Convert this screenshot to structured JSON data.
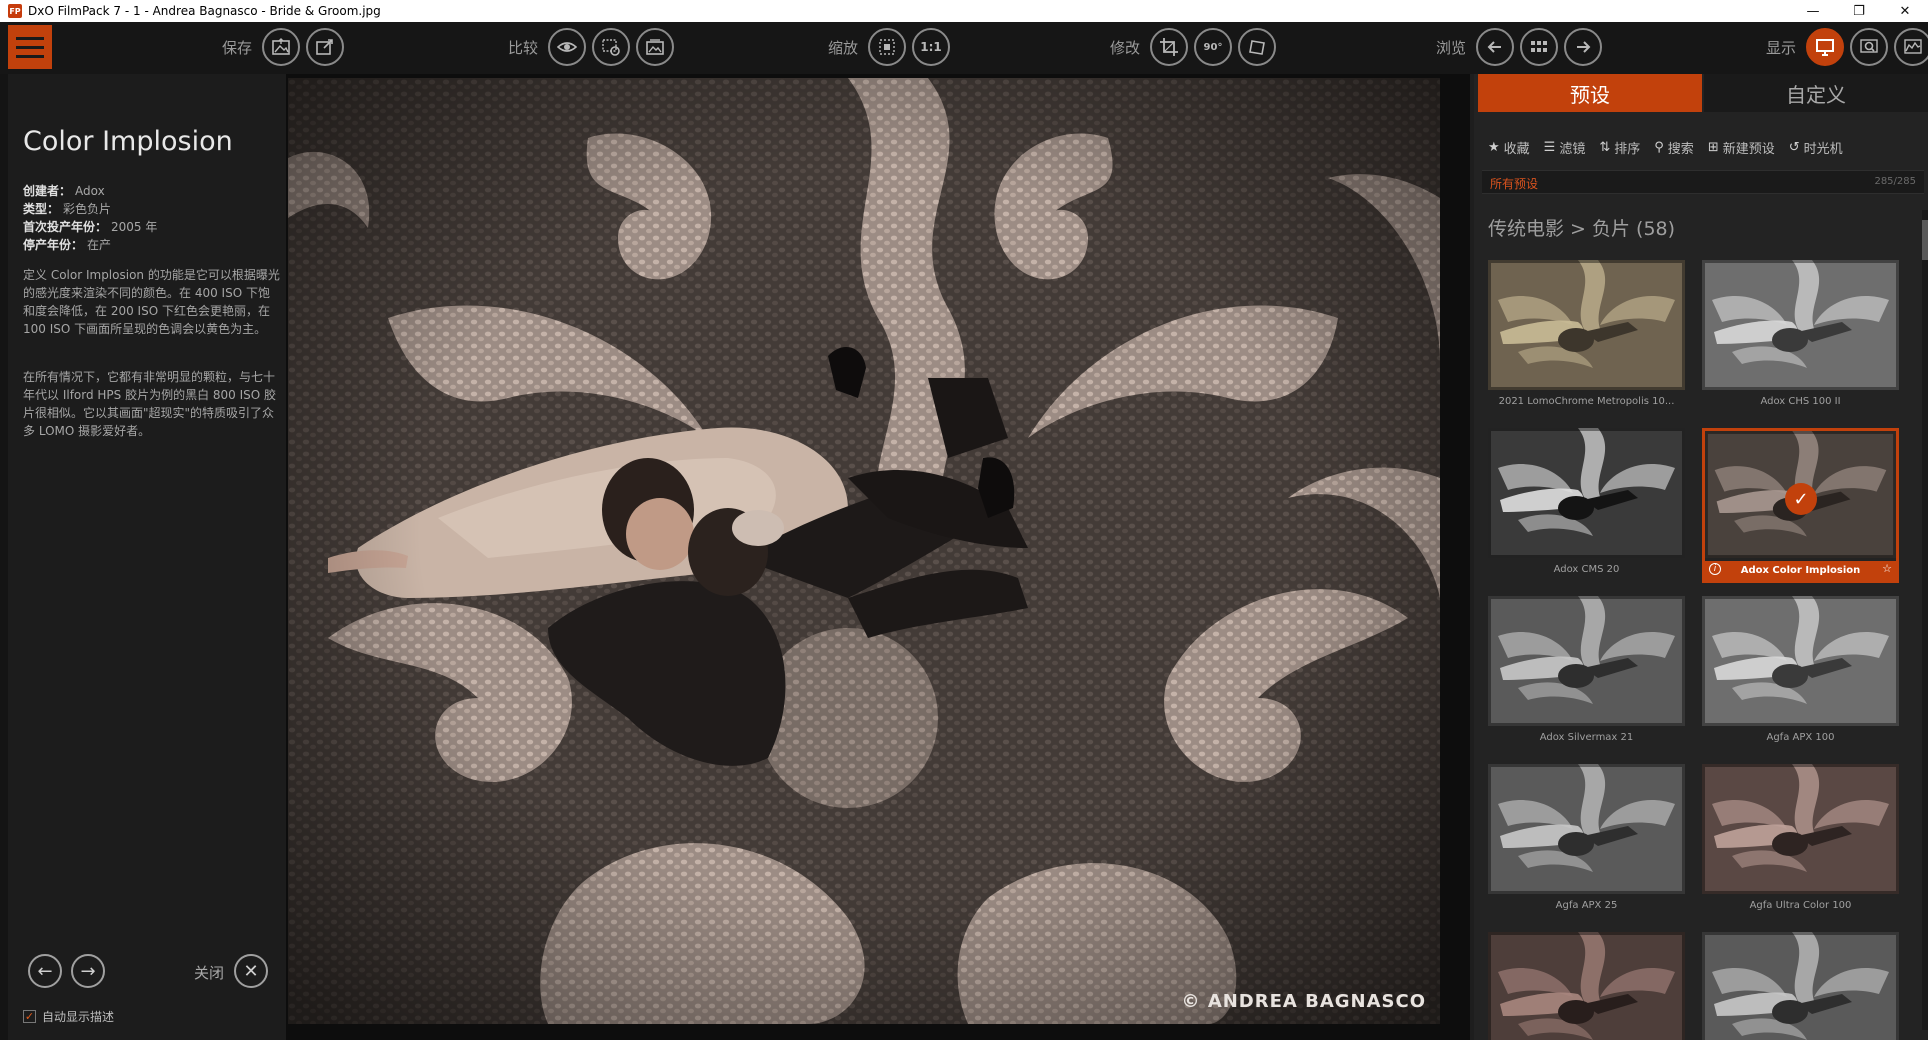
{
  "window": {
    "title": "DxO FilmPack 7 - 1 - Andrea Bagnasco - Bride & Groom.jpg",
    "app_icon_text": "FP",
    "minimize": "—",
    "maximize": "❐",
    "close": "✕"
  },
  "toolbar": {
    "save_label": "保存",
    "compare_label": "比较",
    "zoom_label": "缩放",
    "zoom_one_to_one": "1:1",
    "edit_label": "修改",
    "rotate_label": "90°",
    "browse_label": "浏览",
    "display_label": "显示"
  },
  "info": {
    "title": "Color Implosion",
    "rows": [
      {
        "k": "创建者：",
        "v": "Adox"
      },
      {
        "k": "类型：",
        "v": "彩色负片"
      },
      {
        "k": "首次投产年份：",
        "v": "2005 年"
      },
      {
        "k": "停产年份：",
        "v": "在产"
      }
    ],
    "desc1": "定义 Color Implosion 的功能是它可以根据曝光的感光度来渲染不同的颜色。在 400 ISO 下饱和度会降低，在 200 ISO 下红色会更艳丽，在 100 ISO 下画面所呈现的色调会以黄色为主。",
    "desc2": "在所有情况下，它都有非常明显的颗粒，与七十年代以 Ilford HPS 胶片为例的黑白 800 ISO 胶片很相似。它以其画面\"超现实\"的特质吸引了众多 LOMO 摄影爱好者。",
    "close_label": "关闭",
    "auto_desc_label": "自动显示描述"
  },
  "viewer": {
    "copyright": "© ANDREA BAGNASCO"
  },
  "presets": {
    "tab_presets": "预设",
    "tab_custom": "自定义",
    "filters": {
      "favorites": "收藏",
      "filter": "滤镜",
      "sort": "排序",
      "search": "搜索",
      "new_preset": "新建预设",
      "time_machine": "时光机"
    },
    "all_presets": "所有预设",
    "count": "285/285",
    "category": "传统电影 > 负片 (58)",
    "items": [
      {
        "label": "2021 LomoChrome Metropolis 10...",
        "tone": "warm-faded"
      },
      {
        "label": "Adox CHS 100 II",
        "tone": "bw-light"
      },
      {
        "label": "Adox CMS 20",
        "tone": "bw-contrast"
      },
      {
        "label": "Adox Color Implosion",
        "tone": "sepia-dark",
        "selected": true
      },
      {
        "label": "Adox Silvermax 21",
        "tone": "bw-mid"
      },
      {
        "label": "Agfa APX 100",
        "tone": "bw-light"
      },
      {
        "label": "Agfa APX 25",
        "tone": "bw-mid"
      },
      {
        "label": "Agfa Ultra Color 100",
        "tone": "rose"
      },
      {
        "label": "",
        "tone": "rose-dark"
      },
      {
        "label": "",
        "tone": "bw-mid"
      }
    ]
  },
  "colors": {
    "accent": "#c2410c"
  }
}
